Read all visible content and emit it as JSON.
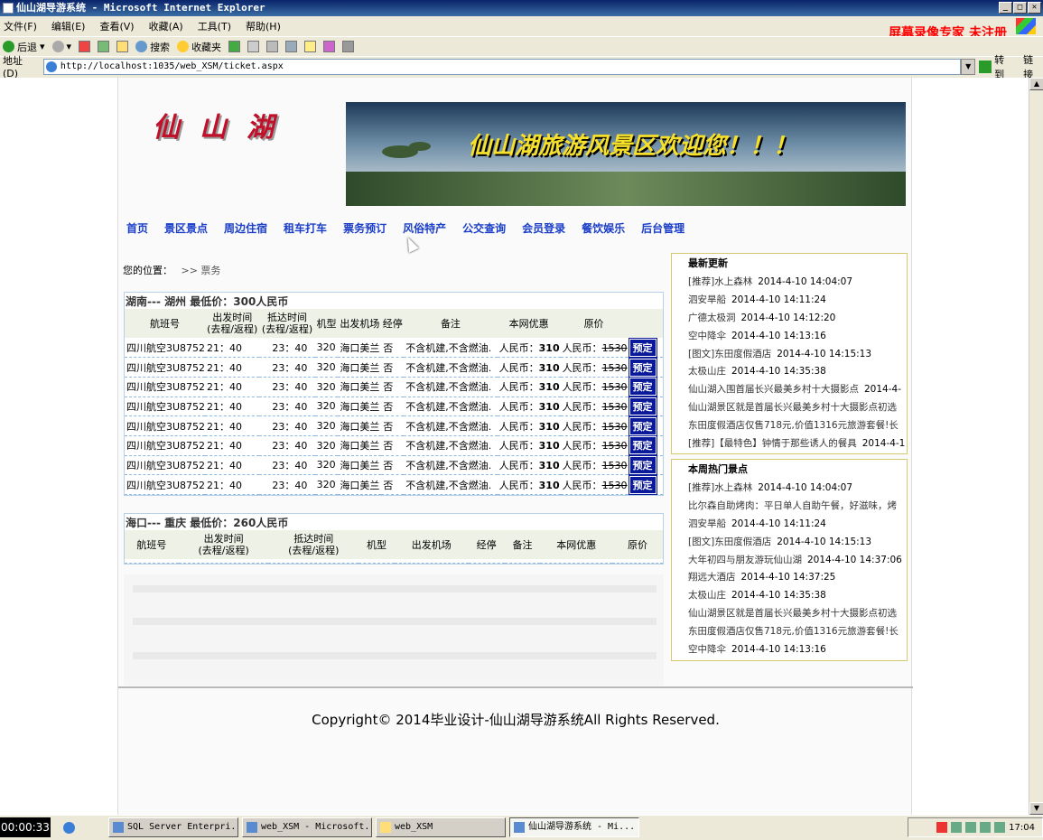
{
  "window": {
    "title": "仙山湖导游系统 - Microsoft Internet Explorer",
    "watermark": "屏幕录像专家  未注册"
  },
  "menu": [
    "文件(F)",
    "编辑(E)",
    "查看(V)",
    "收藏(A)",
    "工具(T)",
    "帮助(H)"
  ],
  "toolbar": {
    "back": "后退",
    "search": "搜索",
    "favorites": "收藏夹"
  },
  "address": {
    "label": "地址(D)",
    "url": "http://localhost:1035/web_XSM/ticket.aspx",
    "go": "转到",
    "links": "链接"
  },
  "site": {
    "logo": "仙山湖",
    "banner": "仙山湖旅游风景区欢迎您！！！",
    "nav": [
      "首页",
      "景区景点",
      "周边住宿",
      "租车打车",
      "票务预订",
      "风俗特产",
      "公交查询",
      "会员登录",
      "餐饮娱乐",
      "后台管理"
    ],
    "location_label": "您的位置：",
    "location_path": ">> 票务"
  },
  "sections": [
    {
      "title": "湖南--- 湖州  最低价：300人民币",
      "headers": [
        "航班号",
        "出发时间\n(去程/返程)",
        "抵达时间\n(去程/返程)",
        "机型",
        "出发机场",
        "经停",
        "备注",
        "本网优惠",
        "原价",
        ""
      ],
      "rows": [
        {
          "flight": "四川航空3U8752",
          "dep": "21：40",
          "arr": "23：40",
          "type": "320",
          "airport": "海口美兰",
          "stop": "否",
          "note": "不含机建,不含燃油.",
          "deal_label": "人民币：",
          "deal": "310",
          "orig_label": "人民币：",
          "orig": "1530",
          "book": "预定"
        },
        {
          "flight": "四川航空3U8752",
          "dep": "21：40",
          "arr": "23：40",
          "type": "320",
          "airport": "海口美兰",
          "stop": "否",
          "note": "不含机建,不含燃油.",
          "deal_label": "人民币：",
          "deal": "310",
          "orig_label": "人民币：",
          "orig": "1530",
          "book": "预定"
        },
        {
          "flight": "四川航空3U8752",
          "dep": "21：40",
          "arr": "23：40",
          "type": "320",
          "airport": "海口美兰",
          "stop": "否",
          "note": "不含机建,不含燃油.",
          "deal_label": "人民币：",
          "deal": "310",
          "orig_label": "人民币：",
          "orig": "1530",
          "book": "预定"
        },
        {
          "flight": "四川航空3U8752",
          "dep": "21：40",
          "arr": "23：40",
          "type": "320",
          "airport": "海口美兰",
          "stop": "否",
          "note": "不含机建,不含燃油.",
          "deal_label": "人民币：",
          "deal": "310",
          "orig_label": "人民币：",
          "orig": "1530",
          "book": "预定"
        },
        {
          "flight": "四川航空3U8752",
          "dep": "21：40",
          "arr": "23：40",
          "type": "320",
          "airport": "海口美兰",
          "stop": "否",
          "note": "不含机建,不含燃油.",
          "deal_label": "人民币：",
          "deal": "310",
          "orig_label": "人民币：",
          "orig": "1530",
          "book": "预定"
        },
        {
          "flight": "四川航空3U8752",
          "dep": "21：40",
          "arr": "23：40",
          "type": "320",
          "airport": "海口美兰",
          "stop": "否",
          "note": "不含机建,不含燃油.",
          "deal_label": "人民币：",
          "deal": "310",
          "orig_label": "人民币：",
          "orig": "1530",
          "book": "预定"
        },
        {
          "flight": "四川航空3U8752",
          "dep": "21：40",
          "arr": "23：40",
          "type": "320",
          "airport": "海口美兰",
          "stop": "否",
          "note": "不含机建,不含燃油.",
          "deal_label": "人民币：",
          "deal": "310",
          "orig_label": "人民币：",
          "orig": "1530",
          "book": "预定"
        },
        {
          "flight": "四川航空3U8752",
          "dep": "21：40",
          "arr": "23：40",
          "type": "320",
          "airport": "海口美兰",
          "stop": "否",
          "note": "不含机建,不含燃油.",
          "deal_label": "人民币：",
          "deal": "310",
          "orig_label": "人民币：",
          "orig": "1530",
          "book": "预定"
        }
      ]
    },
    {
      "title": "海口--- 重庆  最低价：260人民币",
      "headers": [
        "航班号",
        "出发时间\n(去程/返程)",
        "抵达时间\n(去程/返程)",
        "机型",
        "出发机场",
        "经停",
        "备注",
        "本网优惠",
        "原价"
      ],
      "rows": []
    }
  ],
  "sidebar": {
    "latest": {
      "title": "最新更新",
      "items": [
        {
          "text": "[推荐]水上森林",
          "date": "2014-4-10 14:04:07"
        },
        {
          "text": "泗安旱船",
          "date": "2014-4-10 14:11:24"
        },
        {
          "text": "广德太极洞",
          "date": "2014-4-10 14:12:20"
        },
        {
          "text": "空中降伞",
          "date": "2014-4-10 14:13:16"
        },
        {
          "text": "[图文]东田度假酒店",
          "date": "2014-4-10 14:15:13"
        },
        {
          "text": "太极山庄",
          "date": "2014-4-10 14:35:38"
        },
        {
          "text": "仙山湖入围首届长兴最美乡村十大摄影点",
          "date": "2014-4-"
        },
        {
          "text": "仙山湖景区就是首届长兴最美乡村十大摄影点初选",
          "date": ""
        },
        {
          "text": "东田度假酒店仅售718元,价值1316元旅游套餐!长",
          "date": ""
        },
        {
          "text": "[推荐]【最特色】钟情于那些诱人的餐具",
          "date": "2014-4-1"
        }
      ]
    },
    "hot": {
      "title": "本周热门景点",
      "items": [
        {
          "text": "[推荐]水上森林",
          "date": "2014-4-10 14:04:07"
        },
        {
          "text": "比尔森自助烤肉：平日单人自助午餐，好滋味，烤",
          "date": ""
        },
        {
          "text": "泗安旱船",
          "date": "2014-4-10 14:11:24"
        },
        {
          "text": "[图文]东田度假酒店",
          "date": "2014-4-10 14:15:13"
        },
        {
          "text": "大年初四与朋友游玩仙山湖",
          "date": "2014-4-10 14:37:06"
        },
        {
          "text": "翔远大酒店",
          "date": "2014-4-10 14:37:25"
        },
        {
          "text": "太极山庄",
          "date": "2014-4-10 14:35:38"
        },
        {
          "text": "仙山湖景区就是首届长兴最美乡村十大摄影点初选",
          "date": ""
        },
        {
          "text": "东田度假酒店仅售718元,价值1316元旅游套餐!长",
          "date": ""
        },
        {
          "text": "空中降伞",
          "date": "2014-4-10 14:13:16"
        }
      ]
    }
  },
  "footer": "Copyright© 2014毕业设计-仙山湖导游系统All Rights Reserved.",
  "taskbar": {
    "timer": "00:00:33",
    "tasks": [
      "SQL Server Enterpri...",
      "web_XSM - Microsoft...",
      "web_XSM",
      "仙山湖导游系统 - Mi..."
    ],
    "clock": "17:04"
  }
}
